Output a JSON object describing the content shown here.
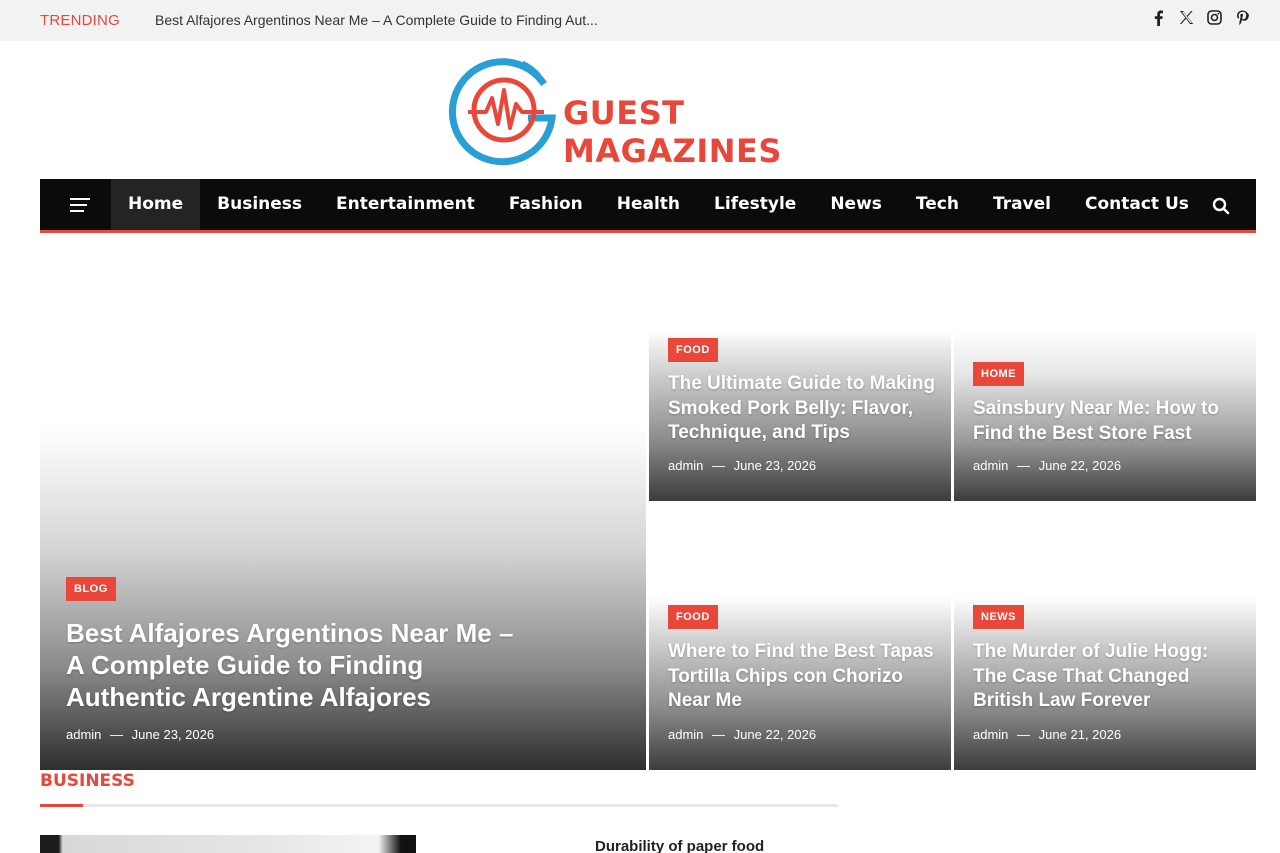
{
  "topbar": {
    "trending_label": "TRENDING",
    "trending_title": "Best Alfajores Argentinos Near Me – A Complete Guide to Finding Aut...",
    "social_icons": [
      "facebook-icon",
      "x-icon",
      "instagram-icon",
      "pinterest-icon"
    ]
  },
  "logo": {
    "text": "GUEST MAGAZINES",
    "colors": {
      "ring": "#2a9fd6",
      "accent": "#e8473a"
    }
  },
  "nav": {
    "items": [
      {
        "label": "Home",
        "active": true
      },
      {
        "label": "Business"
      },
      {
        "label": "Entertainment"
      },
      {
        "label": "Fashion"
      },
      {
        "label": "Health"
      },
      {
        "label": "Lifestyle"
      },
      {
        "label": "News"
      },
      {
        "label": "Tech"
      },
      {
        "label": "Travel"
      },
      {
        "label": "Contact Us"
      }
    ]
  },
  "featured": {
    "main": {
      "category": "BLOG",
      "title": "Best Alfajores Argentinos Near Me – A Complete Guide to Finding Authentic Argentine Alfajores",
      "author": "admin",
      "date": "June 23, 2026"
    },
    "cards": [
      {
        "category": "FOOD",
        "title": "The Ultimate Guide to Making Smoked Pork Belly: Flavor, Technique, and Tips",
        "author": "admin",
        "date": "June 23, 2026"
      },
      {
        "category": "HOME",
        "title": "Sainsbury Near Me: How to Find the Best Store Fast",
        "author": "admin",
        "date": "June 22, 2026"
      },
      {
        "category": "FOOD",
        "title": "Where to Find the Best Tapas Tortilla Chips con Chorizo Near Me",
        "author": "admin",
        "date": "June 22, 2026"
      },
      {
        "category": "NEWS",
        "title": "The Murder of Julie Hogg: The Case That Changed British Law Forever",
        "author": "admin",
        "date": "June 21, 2026"
      }
    ]
  },
  "business": {
    "section_title": "BUSINESS",
    "post_title": "Durability of paper food"
  },
  "meta_separator": "—",
  "colors": {
    "accent": "#e8473a",
    "nav_bg": "#0b0b0b"
  }
}
